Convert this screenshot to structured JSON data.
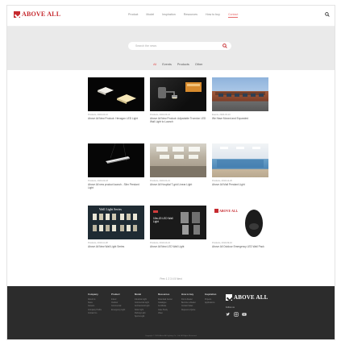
{
  "header": {
    "logo_text": "ABOVE ALL",
    "nav": [
      "Product",
      "Model",
      "Inspiration",
      "Resources",
      "How to buy",
      "Contact"
    ],
    "active_nav": "Contact"
  },
  "search": {
    "placeholder": "Search the news"
  },
  "tabs": [
    {
      "label": "All",
      "active": true
    },
    {
      "label": "Events",
      "active": false
    },
    {
      "label": "Products",
      "active": false
    },
    {
      "label": "Other",
      "active": false
    }
  ],
  "posts": [
    {
      "meta": "Products, 2020-04-10",
      "title": "Above All New Product: Hexagon LED Light"
    },
    {
      "meta": "Products, 2020-03-24",
      "title": "Above All New Product: Adjustable Trunnion LED Wall Light to Launch"
    },
    {
      "meta": "Events, 2020-03-10",
      "title": "We Have Moved and Expanded"
    },
    {
      "meta": "Products, 2020-02-18",
      "title": "Above All new product launch - Slim Pendant Light"
    },
    {
      "meta": "Products, 2020-01-21",
      "title": "Above All Hospital T-grid Linear Light"
    },
    {
      "meta": "Products, 2019-12-20",
      "title": "Above All Mall Pendant Light"
    },
    {
      "meta": "Products, 2019-11-28",
      "title": "Above All New Wall Light Series",
      "banner": "Wall Light Series"
    },
    {
      "meta": "Products, 2019-10-24",
      "title": "Above All New LED Wall Light",
      "banner": "10w-20 LED Wall Light"
    },
    {
      "meta": "Products, 2019-09-10",
      "title": "Above All Outdoor Emergency LED Wall Pack",
      "banner": "ABOVE ALL"
    }
  ],
  "pagination": "Prev  1  2  3  4  5  Next",
  "footer": {
    "columns": [
      {
        "title": "Company",
        "items": [
          "About Us",
          "News",
          "Careers",
          "Company Profile",
          "Contact Us"
        ]
      },
      {
        "title": "Product",
        "items": [
          "Indoor",
          "Outdoor",
          "Commercial",
          "Emergency Light"
        ]
      },
      {
        "title": "Model",
        "items": [
          "Industrial Light",
          "Commercial Light",
          "Architectural Light",
          "Solar Light",
          "Parking Light",
          "Sports Light"
        ]
      },
      {
        "title": "Resources",
        "items": [
          "Download Center",
          "Catalogue",
          "Certificate",
          "Case Study",
          "Video"
        ]
      },
      {
        "title": "How to buy",
        "items": [
          "Find a Dealer",
          "Become a Dealer",
          "Contact Sales",
          "Request a Quote"
        ]
      },
      {
        "title": "Inspiration",
        "items": [
          "Projects",
          "Applications"
        ]
      }
    ],
    "logo_text": "ABOVE ALL",
    "follow_label": "Follow us",
    "copyright": "Copyright © 2020 Above All Lighting Co., Ltd. All Rights Reserved."
  },
  "colors": {
    "brand": "#c62a2f",
    "accent": "#e25a5a",
    "footer_bg": "#2c2c2c"
  }
}
